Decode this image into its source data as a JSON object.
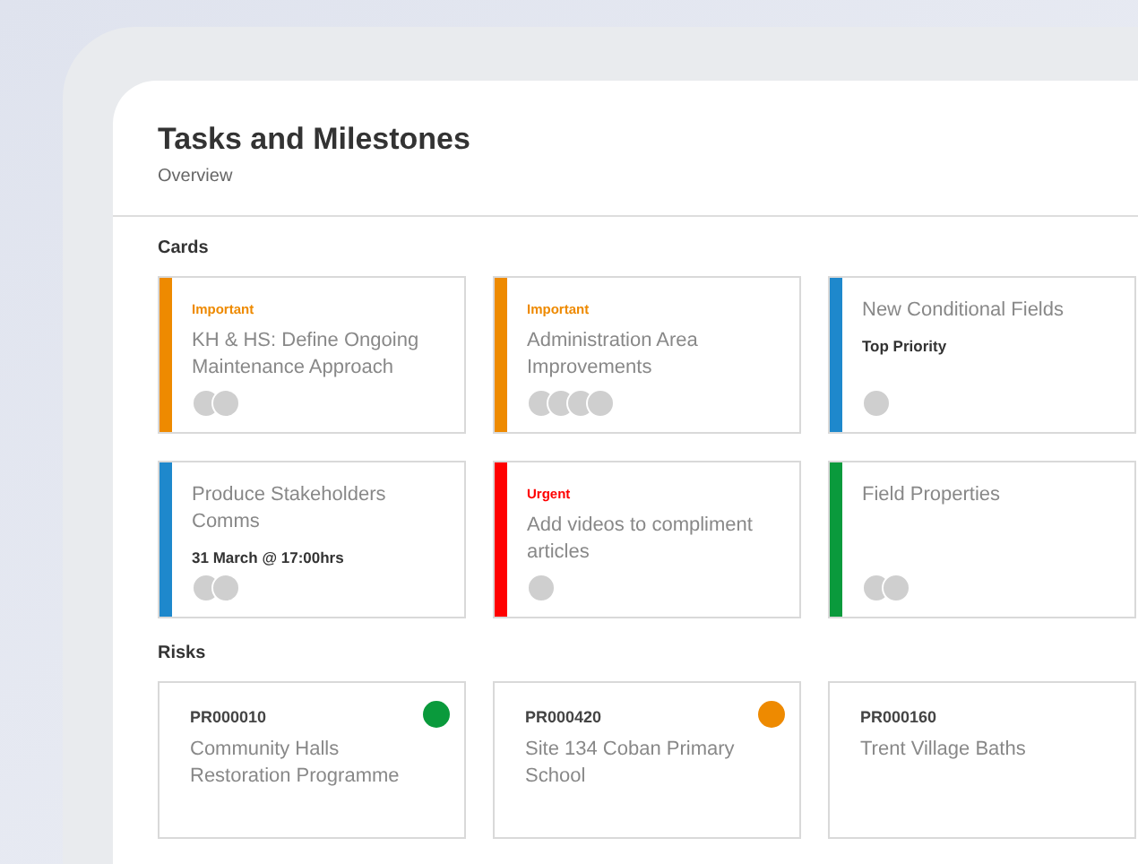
{
  "header": {
    "title": "Tasks and Milestones",
    "subtitle": "Overview"
  },
  "cards_section": {
    "heading": "Cards",
    "cards": [
      {
        "color": "#ee8a00",
        "tag": {
          "text": "Important",
          "color": "#ee8a00"
        },
        "title": "KH & HS: Define Ongoing Maintenance Approach",
        "avatars": [
          {
            "kind": "circle"
          },
          {
            "kind": "circle"
          }
        ]
      },
      {
        "color": "#ee8a00",
        "tag": {
          "text": "Important",
          "color": "#ee8a00"
        },
        "title": "Administration Area Improvements",
        "avatars": [
          {
            "kind": "circle"
          },
          {
            "kind": "circle"
          },
          {
            "kind": "circle"
          },
          {
            "kind": "circle"
          }
        ]
      },
      {
        "color": "#1e88cc",
        "title": "New Conditional Fields",
        "note": "Top Priority",
        "avatars": [
          {
            "kind": "circle"
          }
        ]
      },
      {
        "color": "#1e88cc",
        "title": "Produce Stakeholders Comms",
        "note": "31 March @ 17:00hrs",
        "avatars": [
          {
            "kind": "circle"
          },
          {
            "kind": "circle"
          }
        ]
      },
      {
        "color": "#ff0000",
        "tag": {
          "text": "Urgent",
          "color": "#ff0000"
        },
        "title": "Add videos to compliment articles",
        "avatars": [
          {
            "kind": "circle"
          }
        ]
      },
      {
        "color": "#0a9a3c",
        "title": "Field Properties",
        "avatars": [
          {
            "kind": "circle"
          },
          {
            "kind": "circle"
          }
        ]
      }
    ]
  },
  "risks_section": {
    "heading": "Risks",
    "risks": [
      {
        "code": "PR000010",
        "title": "Community Halls Restoration Programme",
        "color": "#0a9a3c"
      },
      {
        "code": "PR000420",
        "title": "Site 134 Coban Primary School",
        "color": "#ee8a00"
      },
      {
        "code": "PR000160",
        "title": "Trent Village Baths"
      }
    ]
  }
}
